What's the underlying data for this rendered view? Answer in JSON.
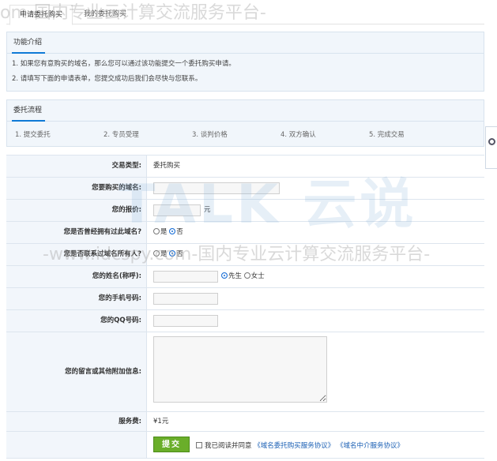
{
  "tabs": [
    {
      "label": "申请委托购买"
    },
    {
      "label": "我的委托购买"
    }
  ],
  "intro": {
    "title": "功能介绍",
    "lines": [
      "1. 如果您有意购买的域名，那么您可以通过该功能提交一个委托购买申请。",
      "2. 请填写下面的申请表单，您提交成功后我们会尽快与您联系。"
    ]
  },
  "flow": {
    "title": "委托流程",
    "steps": [
      "1. 提交委托",
      "2. 专员受理",
      "3. 谈判价格",
      "4. 双方确认",
      "5. 完成交易"
    ]
  },
  "form": {
    "trade_type_label": "交易类型:",
    "trade_type_value": "委托购买",
    "domain_label": "您要购买的域名:",
    "price_label": "您的报价:",
    "price_unit": "元",
    "owned_label": "您是否曾经拥有过此域名?",
    "contacted_label": "您是否联系过域名所有人?",
    "yes": "是",
    "no": "否",
    "name_label": "您的姓名(称呼):",
    "mr": "先生",
    "ms": "女士",
    "phone_label": "您的手机号码:",
    "qq_label": "您的QQ号码:",
    "message_label": "您的留言或其他附加信息:",
    "fee_label": "服务费:",
    "fee_value": "¥1元",
    "submit": "提交",
    "agree_text": "我已阅读并同意",
    "agreement1": "《域名委托购买服务协议》",
    "agreement2": "《域名中介服务协议》"
  },
  "watermark": {
    "line_top": "om-国内专业云计算交流服务平台-",
    "line_mid": "-www.idcspy.com-国内专业云计算交流服务平台-",
    "brand": "TALK 云说"
  },
  "colors": {
    "accent": "#0f7ad6",
    "panel": "#f1f6fb",
    "submit": "#6aae2a",
    "fee": "#e23a2e"
  }
}
